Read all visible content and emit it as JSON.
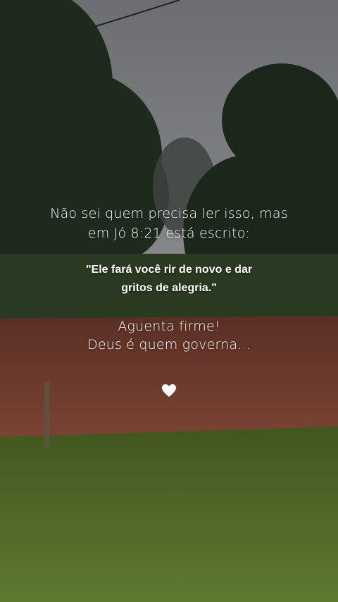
{
  "text": {
    "line1": "Não sei quem precisa ler isso, mas",
    "line2": "em Jó 8:21 está escrito:",
    "quote_line1": "\"Ele fará você rir de novo e dar",
    "quote_line2": "gritos de alegria.\"",
    "line3": "Aguenta firme!",
    "line4": "Deus é quem governa..."
  },
  "icons": {
    "heart": "white-heart-icon"
  },
  "colors": {
    "text": "#ffffff",
    "sky": "#7a7d80",
    "dirt": "#6b3a2c",
    "grass": "#4c6a2c"
  }
}
